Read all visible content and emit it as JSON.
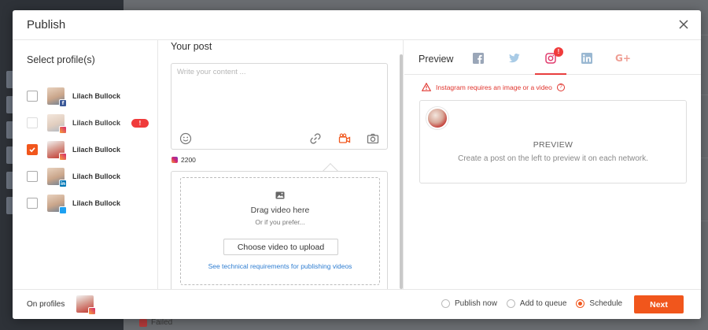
{
  "background": {
    "failed_label": "Failed"
  },
  "modal": {
    "title": "Publish"
  },
  "profiles": {
    "heading": "Select profile(s)",
    "items": [
      {
        "name": "Lilach Bullock",
        "network": "facebook",
        "checked": false,
        "error": false
      },
      {
        "name": "Lilach Bullock",
        "network": "instagram",
        "checked": false,
        "error": true
      },
      {
        "name": "Lilach Bullock",
        "network": "instagram",
        "checked": true,
        "error": false
      },
      {
        "name": "Lilach Bullock",
        "network": "linkedin",
        "checked": false,
        "error": false
      },
      {
        "name": "Lilach Bullock",
        "network": "twitter",
        "checked": false,
        "error": false
      }
    ],
    "error_badge": "!"
  },
  "post": {
    "heading": "Your post",
    "placeholder": "Write your content ...",
    "char_count": "2200",
    "upload": {
      "title": "Drag video here",
      "subtitle": "Or if you prefer...",
      "button": "Choose video to upload",
      "link": "See technical requirements for publishing videos"
    }
  },
  "preview": {
    "heading": "Preview",
    "tabs": [
      "facebook",
      "twitter",
      "instagram",
      "linkedin",
      "google-plus"
    ],
    "active_tab": "instagram",
    "tab_badge": "!",
    "google_plus_label": "G+",
    "warning": "Instagram requires an image or a video",
    "help": "?",
    "card_title": "PREVIEW",
    "card_subtitle": "Create a post on the left to preview it on each network."
  },
  "footer": {
    "on_profiles": "On profiles",
    "options": [
      "Publish now",
      "Add to queue",
      "Schedule"
    ],
    "selected_option": "Schedule",
    "next_label": "Next"
  },
  "colors": {
    "accent": "#f1561c",
    "error": "#f03b3b",
    "link": "#2e7dd1",
    "facebook": "#3b5998",
    "twitter": "#1da1f2",
    "linkedin": "#0077b5",
    "google_plus": "#dd4b39"
  }
}
